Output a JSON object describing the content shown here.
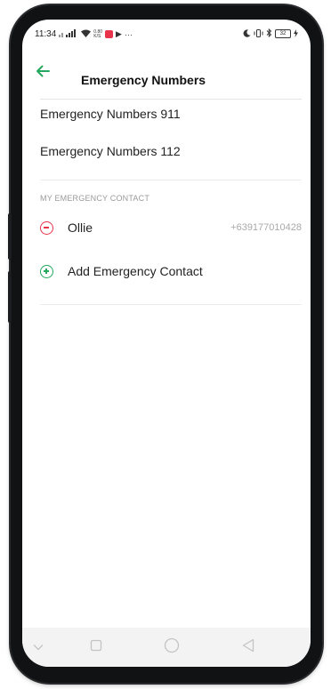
{
  "status_bar": {
    "time": "11:34",
    "speed_top": "0.80",
    "speed_bottom": "K/S",
    "battery": "32"
  },
  "header": {
    "title": "Emergency Numbers"
  },
  "emergency_numbers": [
    {
      "label": "Emergency Numbers 911"
    },
    {
      "label": "Emergency Numbers 112"
    }
  ],
  "my_contacts": {
    "section_label": "MY EMERGENCY CONTACT",
    "contacts": [
      {
        "name": "Ollie",
        "phone": "+639177010428"
      }
    ],
    "add_label": "Add Emergency Contact"
  },
  "icons": {
    "back": "arrow-left-icon",
    "remove": "minus-circle-icon",
    "add": "plus-circle-icon",
    "nav": [
      "chevron-down-icon",
      "square-icon",
      "circle-icon",
      "triangle-back-icon"
    ]
  },
  "colors": {
    "accent_green": "#23a85c",
    "remove_red": "#e8334a",
    "secondary_text": "#a8a8a8"
  }
}
